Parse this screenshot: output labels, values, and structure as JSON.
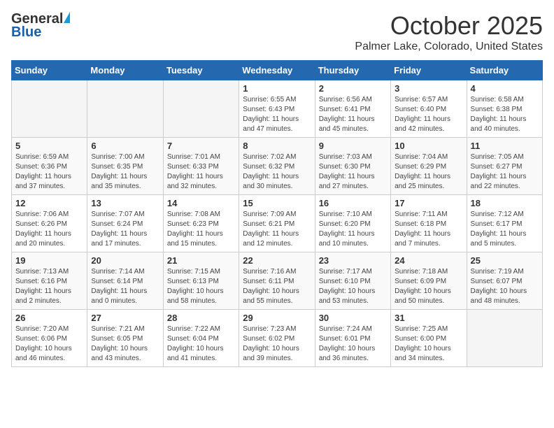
{
  "header": {
    "logo_general": "General",
    "logo_blue": "Blue",
    "month": "October 2025",
    "location": "Palmer Lake, Colorado, United States"
  },
  "days_of_week": [
    "Sunday",
    "Monday",
    "Tuesday",
    "Wednesday",
    "Thursday",
    "Friday",
    "Saturday"
  ],
  "weeks": [
    {
      "cells": [
        {
          "day": "",
          "empty": true
        },
        {
          "day": "",
          "empty": true
        },
        {
          "day": "",
          "empty": true
        },
        {
          "day": "1",
          "sunrise": "6:55 AM",
          "sunset": "6:43 PM",
          "daylight": "11 hours and 47 minutes."
        },
        {
          "day": "2",
          "sunrise": "6:56 AM",
          "sunset": "6:41 PM",
          "daylight": "11 hours and 45 minutes."
        },
        {
          "day": "3",
          "sunrise": "6:57 AM",
          "sunset": "6:40 PM",
          "daylight": "11 hours and 42 minutes."
        },
        {
          "day": "4",
          "sunrise": "6:58 AM",
          "sunset": "6:38 PM",
          "daylight": "11 hours and 40 minutes."
        }
      ]
    },
    {
      "cells": [
        {
          "day": "5",
          "sunrise": "6:59 AM",
          "sunset": "6:36 PM",
          "daylight": "11 hours and 37 minutes."
        },
        {
          "day": "6",
          "sunrise": "7:00 AM",
          "sunset": "6:35 PM",
          "daylight": "11 hours and 35 minutes."
        },
        {
          "day": "7",
          "sunrise": "7:01 AM",
          "sunset": "6:33 PM",
          "daylight": "11 hours and 32 minutes."
        },
        {
          "day": "8",
          "sunrise": "7:02 AM",
          "sunset": "6:32 PM",
          "daylight": "11 hours and 30 minutes."
        },
        {
          "day": "9",
          "sunrise": "7:03 AM",
          "sunset": "6:30 PM",
          "daylight": "11 hours and 27 minutes."
        },
        {
          "day": "10",
          "sunrise": "7:04 AM",
          "sunset": "6:29 PM",
          "daylight": "11 hours and 25 minutes."
        },
        {
          "day": "11",
          "sunrise": "7:05 AM",
          "sunset": "6:27 PM",
          "daylight": "11 hours and 22 minutes."
        }
      ]
    },
    {
      "cells": [
        {
          "day": "12",
          "sunrise": "7:06 AM",
          "sunset": "6:26 PM",
          "daylight": "11 hours and 20 minutes."
        },
        {
          "day": "13",
          "sunrise": "7:07 AM",
          "sunset": "6:24 PM",
          "daylight": "11 hours and 17 minutes."
        },
        {
          "day": "14",
          "sunrise": "7:08 AM",
          "sunset": "6:23 PM",
          "daylight": "11 hours and 15 minutes."
        },
        {
          "day": "15",
          "sunrise": "7:09 AM",
          "sunset": "6:21 PM",
          "daylight": "11 hours and 12 minutes."
        },
        {
          "day": "16",
          "sunrise": "7:10 AM",
          "sunset": "6:20 PM",
          "daylight": "11 hours and 10 minutes."
        },
        {
          "day": "17",
          "sunrise": "7:11 AM",
          "sunset": "6:18 PM",
          "daylight": "11 hours and 7 minutes."
        },
        {
          "day": "18",
          "sunrise": "7:12 AM",
          "sunset": "6:17 PM",
          "daylight": "11 hours and 5 minutes."
        }
      ]
    },
    {
      "cells": [
        {
          "day": "19",
          "sunrise": "7:13 AM",
          "sunset": "6:16 PM",
          "daylight": "11 hours and 2 minutes."
        },
        {
          "day": "20",
          "sunrise": "7:14 AM",
          "sunset": "6:14 PM",
          "daylight": "11 hours and 0 minutes."
        },
        {
          "day": "21",
          "sunrise": "7:15 AM",
          "sunset": "6:13 PM",
          "daylight": "10 hours and 58 minutes."
        },
        {
          "day": "22",
          "sunrise": "7:16 AM",
          "sunset": "6:11 PM",
          "daylight": "10 hours and 55 minutes."
        },
        {
          "day": "23",
          "sunrise": "7:17 AM",
          "sunset": "6:10 PM",
          "daylight": "10 hours and 53 minutes."
        },
        {
          "day": "24",
          "sunrise": "7:18 AM",
          "sunset": "6:09 PM",
          "daylight": "10 hours and 50 minutes."
        },
        {
          "day": "25",
          "sunrise": "7:19 AM",
          "sunset": "6:07 PM",
          "daylight": "10 hours and 48 minutes."
        }
      ]
    },
    {
      "cells": [
        {
          "day": "26",
          "sunrise": "7:20 AM",
          "sunset": "6:06 PM",
          "daylight": "10 hours and 46 minutes."
        },
        {
          "day": "27",
          "sunrise": "7:21 AM",
          "sunset": "6:05 PM",
          "daylight": "10 hours and 43 minutes."
        },
        {
          "day": "28",
          "sunrise": "7:22 AM",
          "sunset": "6:04 PM",
          "daylight": "10 hours and 41 minutes."
        },
        {
          "day": "29",
          "sunrise": "7:23 AM",
          "sunset": "6:02 PM",
          "daylight": "10 hours and 39 minutes."
        },
        {
          "day": "30",
          "sunrise": "7:24 AM",
          "sunset": "6:01 PM",
          "daylight": "10 hours and 36 minutes."
        },
        {
          "day": "31",
          "sunrise": "7:25 AM",
          "sunset": "6:00 PM",
          "daylight": "10 hours and 34 minutes."
        },
        {
          "day": "",
          "empty": true
        }
      ]
    }
  ]
}
